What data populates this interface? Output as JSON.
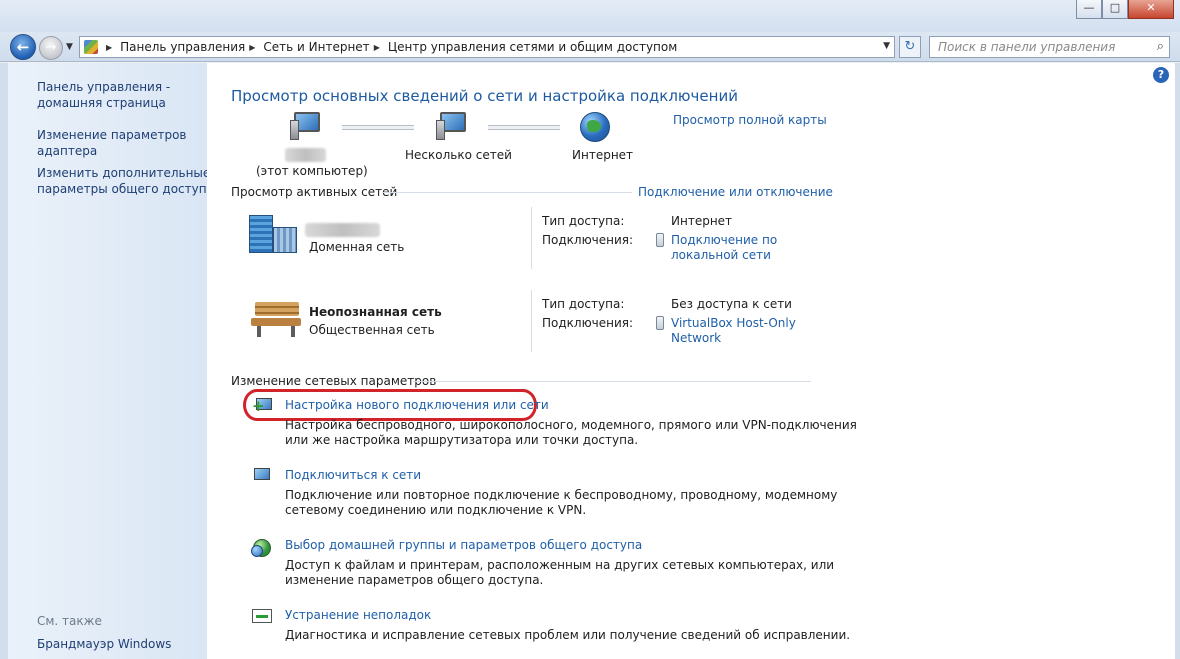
{
  "window": {
    "controls": {
      "minimize": "—",
      "maximize": "□",
      "close": "✕"
    }
  },
  "nav": {
    "breadcrumbs": [
      "Панель управления",
      "Сеть и Интернет",
      "Центр управления сетями и общим доступом"
    ],
    "search_placeholder": "Поиск в панели управления"
  },
  "sidebar": {
    "items": [
      {
        "label": "Панель управления -\nдомашняя страница"
      },
      {
        "label": "Изменение параметров\nадаптера"
      },
      {
        "label": "Изменить дополнительные\nпараметры общего доступа"
      }
    ],
    "see_also": "См. также",
    "firewall": "Брандмауэр Windows"
  },
  "main": {
    "title": "Просмотр основных сведений о сети и настройка подключений",
    "full_map_link": "Просмотр полной карты",
    "map": {
      "computer_label": "(этот компьютер)",
      "networks_label": "Несколько сетей",
      "internet_label": "Интернет"
    },
    "active_networks_header": "Просмотр активных сетей",
    "connect_disconnect_link": "Подключение или отключение",
    "networks": [
      {
        "type": "Доменная сеть",
        "access_label": "Тип доступа:",
        "access_value": "Интернет",
        "connections_label": "Подключения:",
        "connection_link": "Подключение по\nлокальной сети"
      },
      {
        "name": "Неопознанная сеть",
        "type": "Общественная сеть",
        "access_label": "Тип доступа:",
        "access_value": "Без доступа к сети",
        "connections_label": "Подключения:",
        "connection_link": "VirtualBox Host-Only\nNetwork"
      }
    ],
    "change_settings_header": "Изменение сетевых параметров",
    "tasks": [
      {
        "link": "Настройка нового подключения или сети",
        "description": "Настройка беспроводного, широкополосного, модемного, прямого или VPN-подключения\nили же настройка маршрутизатора или точки доступа."
      },
      {
        "link": "Подключиться к сети",
        "description": "Подключение или повторное подключение к беспроводному, проводному, модемному\nсетевому соединению или подключение к VPN."
      },
      {
        "link": "Выбор домашней группы и параметров общего доступа",
        "description": "Доступ к файлам и принтерам, расположенным на других сетевых компьютерах, или\nизменение параметров общего доступа."
      },
      {
        "link": "Устранение неполадок",
        "description": "Диагностика и исправление сетевых проблем или получение сведений об исправлении."
      }
    ]
  },
  "colors": {
    "link": "#1f5fa8",
    "title": "#1e5aa0",
    "highlight": "#d2232a",
    "sidebar_bg": "#dae6f4"
  }
}
